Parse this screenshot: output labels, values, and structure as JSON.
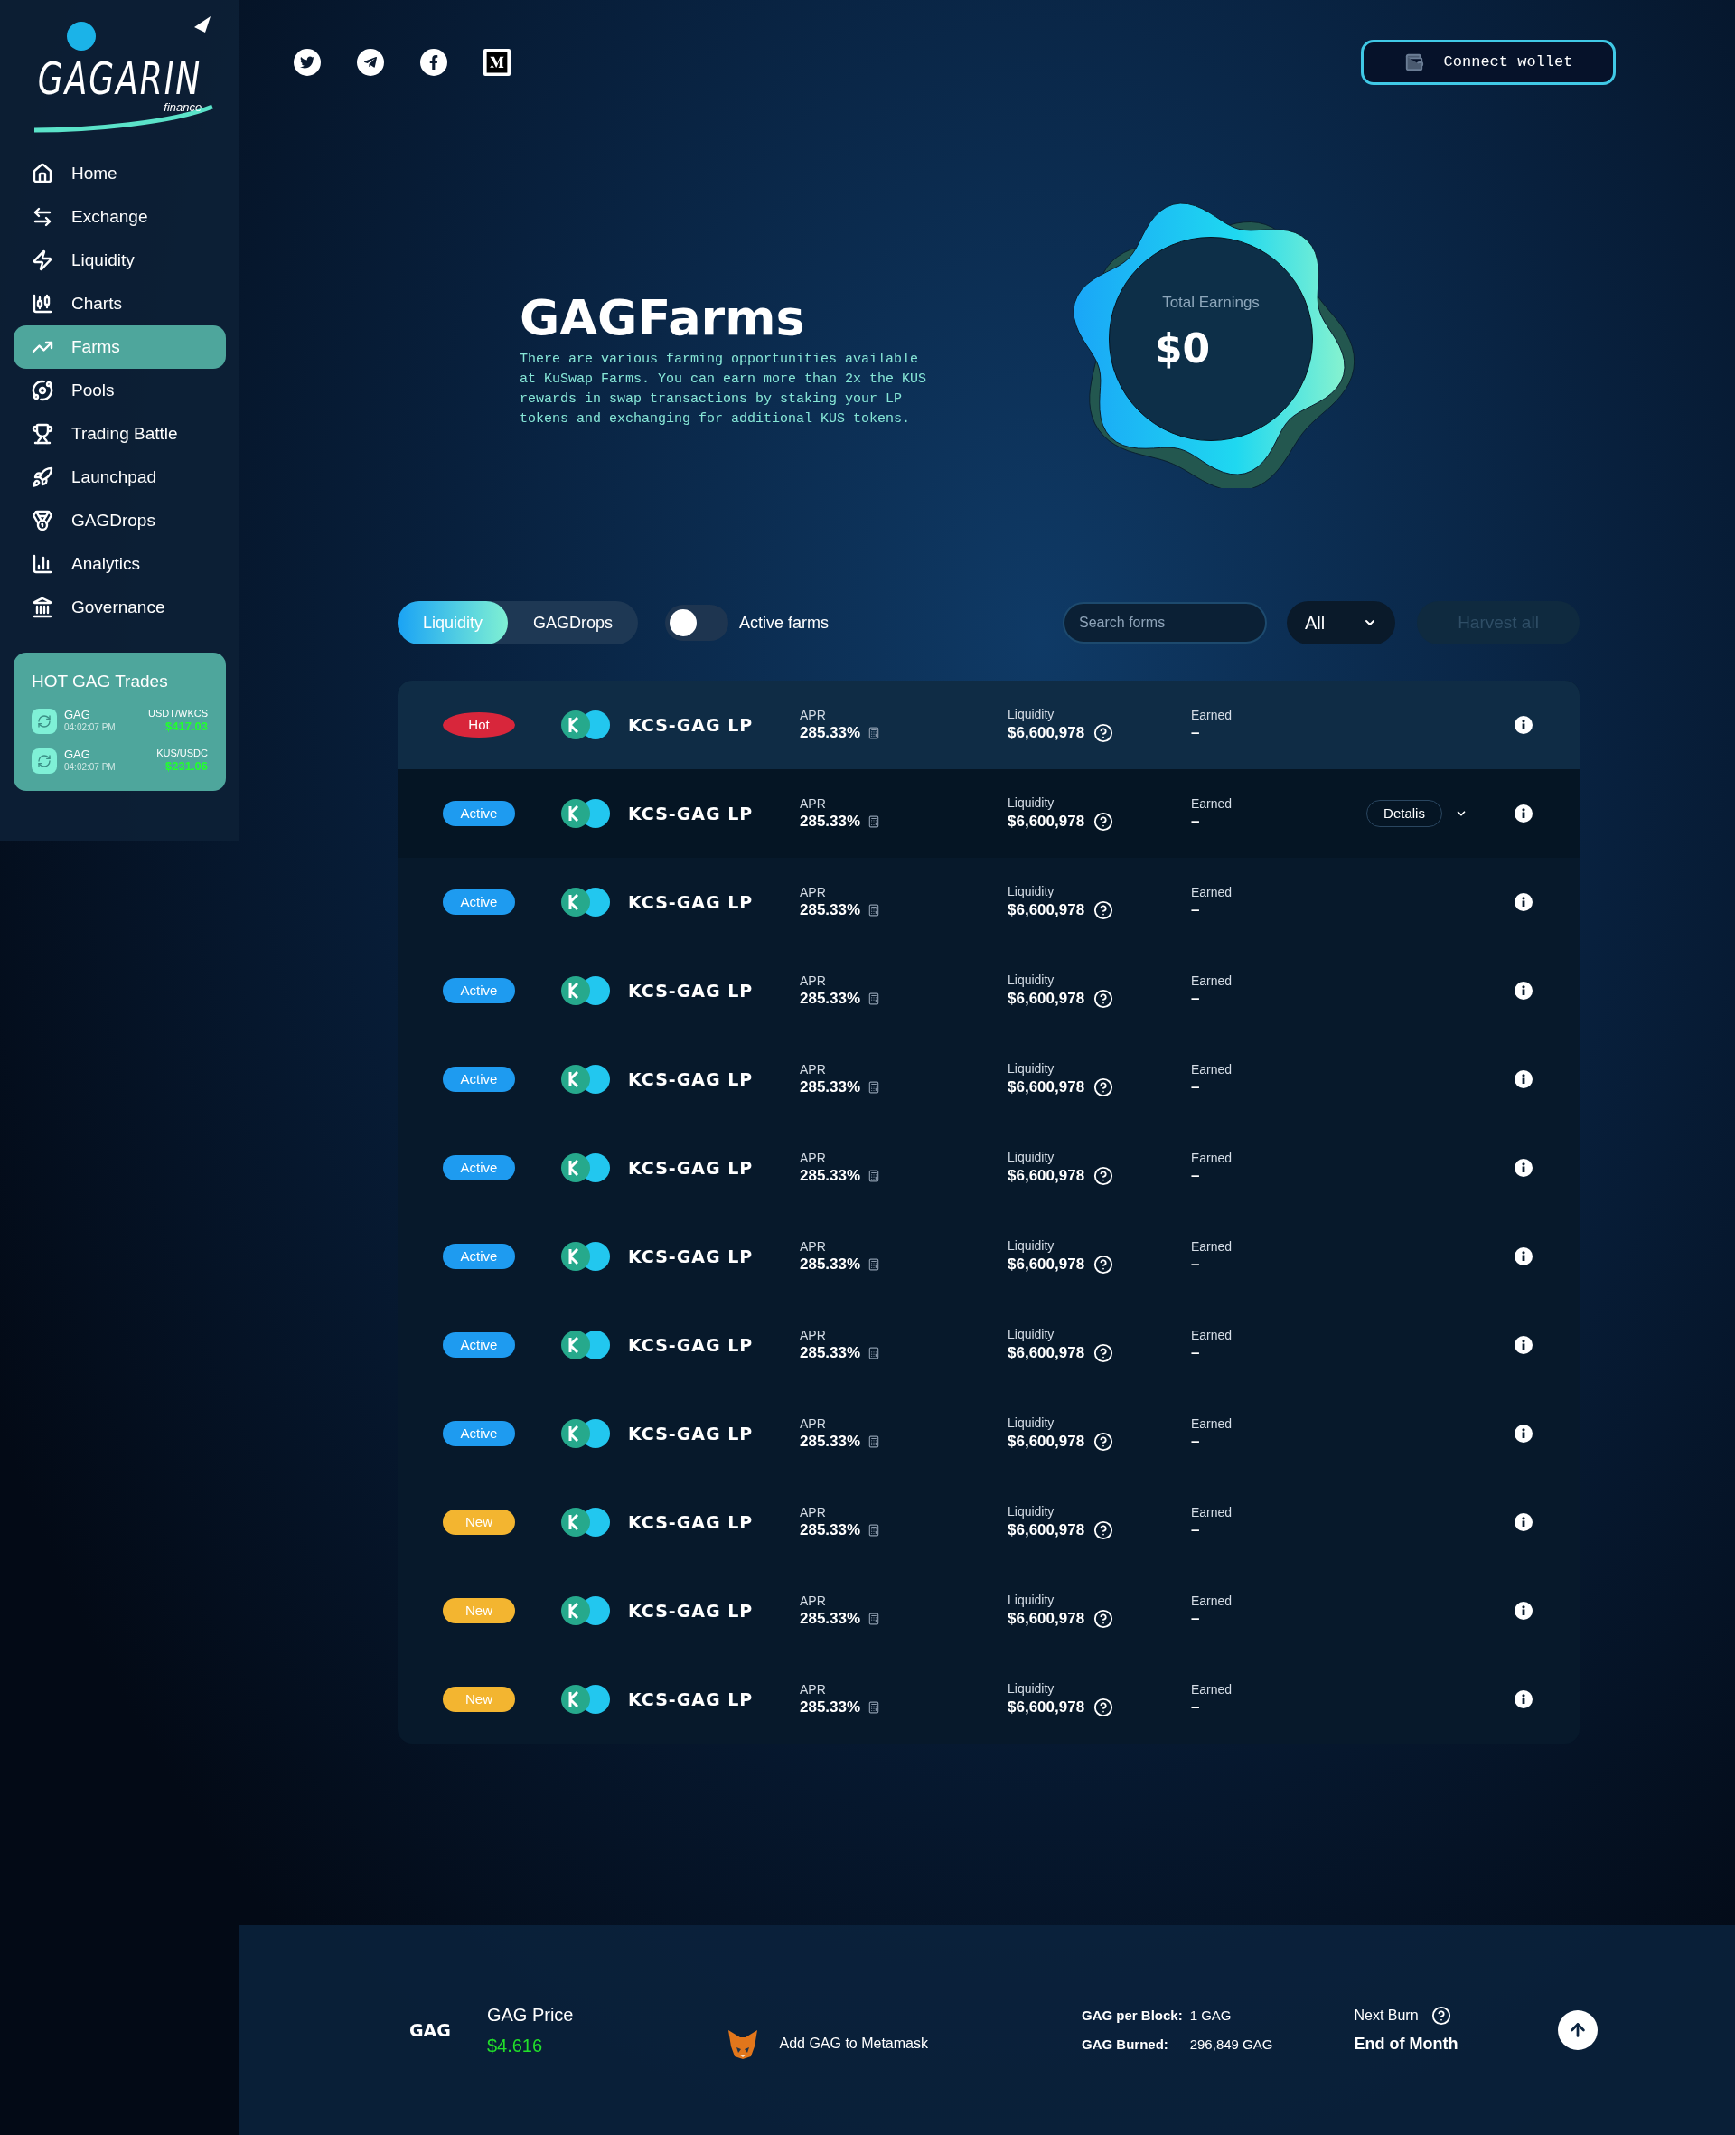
{
  "logo": {
    "name": "GAGARIN",
    "tagline": "finance"
  },
  "sidebar": {
    "items": [
      {
        "label": "Home",
        "selected": false
      },
      {
        "label": "Exchange",
        "selected": false
      },
      {
        "label": "Liquidity",
        "selected": false
      },
      {
        "label": "Charts",
        "selected": false
      },
      {
        "label": "Farms",
        "selected": true
      },
      {
        "label": "Pools",
        "selected": false
      },
      {
        "label": "Trading Battle",
        "selected": false
      },
      {
        "label": "Launchpad",
        "selected": false
      },
      {
        "label": "GAGDrops",
        "selected": false
      },
      {
        "label": "Analytics",
        "selected": false
      },
      {
        "label": "Governance",
        "selected": false
      }
    ]
  },
  "hot_trades": {
    "title": "HOT GAG Trades",
    "items": [
      {
        "token": "GAG",
        "time": "04:02:07 PM",
        "pair": "USDT/WKCS",
        "price": "$417.03"
      },
      {
        "token": "GAG",
        "time": "04:02:07 PM",
        "pair": "KUS/USDC",
        "price": "$231.06"
      }
    ]
  },
  "header": {
    "connect_button": "Connect wollet"
  },
  "hero": {
    "title": "GAGFarms",
    "description": "There are various farming opportunities available at KuSwap Farms. You can earn more than 2x the KUS rewards in swap transactions by staking your LP tokens and exchanging for additional KUS tokens.",
    "earnings_label": "Total Earnings",
    "earnings_value": "$0"
  },
  "filters": {
    "tabs": [
      {
        "label": "Liquidity",
        "selected": true
      },
      {
        "label": "GAGDrops",
        "selected": false
      }
    ],
    "toggle": {
      "label": "Active farms",
      "on": false
    },
    "search": {
      "placeholder": "Search forms"
    },
    "dropdown": "All",
    "harvest_button": {
      "label": "Harvest all",
      "disabled": true
    }
  },
  "farms": [
    {
      "badge": "Hot",
      "kind": "hot",
      "pair": "KCS-GAG LP",
      "apr_label": "APR",
      "apr": "285.33%",
      "liquidity_label": "Liquidity",
      "liquidity": "$6,600,978",
      "earned_label": "Earned",
      "earned": "–"
    },
    {
      "badge": "Active",
      "kind": "active",
      "pair": "KCS-GAG LP",
      "apr_label": "APR",
      "apr": "285.33%",
      "liquidity_label": "Liquidity",
      "liquidity": "$6,600,978",
      "earned_label": "Earned",
      "earned": "–",
      "details": "Detalis"
    },
    {
      "badge": "Active",
      "kind": "active",
      "pair": "KCS-GAG LP",
      "apr_label": "APR",
      "apr": "285.33%",
      "liquidity_label": "Liquidity",
      "liquidity": "$6,600,978",
      "earned_label": "Earned",
      "earned": "–"
    },
    {
      "badge": "Active",
      "kind": "active",
      "pair": "KCS-GAG LP",
      "apr_label": "APR",
      "apr": "285.33%",
      "liquidity_label": "Liquidity",
      "liquidity": "$6,600,978",
      "earned_label": "Earned",
      "earned": "–"
    },
    {
      "badge": "Active",
      "kind": "active",
      "pair": "KCS-GAG LP",
      "apr_label": "APR",
      "apr": "285.33%",
      "liquidity_label": "Liquidity",
      "liquidity": "$6,600,978",
      "earned_label": "Earned",
      "earned": "–"
    },
    {
      "badge": "Active",
      "kind": "active",
      "pair": "KCS-GAG LP",
      "apr_label": "APR",
      "apr": "285.33%",
      "liquidity_label": "Liquidity",
      "liquidity": "$6,600,978",
      "earned_label": "Earned",
      "earned": "–"
    },
    {
      "badge": "Active",
      "kind": "active",
      "pair": "KCS-GAG LP",
      "apr_label": "APR",
      "apr": "285.33%",
      "liquidity_label": "Liquidity",
      "liquidity": "$6,600,978",
      "earned_label": "Earned",
      "earned": "–"
    },
    {
      "badge": "Active",
      "kind": "active",
      "pair": "KCS-GAG LP",
      "apr_label": "APR",
      "apr": "285.33%",
      "liquidity_label": "Liquidity",
      "liquidity": "$6,600,978",
      "earned_label": "Earned",
      "earned": "–"
    },
    {
      "badge": "Active",
      "kind": "active",
      "pair": "KCS-GAG LP",
      "apr_label": "APR",
      "apr": "285.33%",
      "liquidity_label": "Liquidity",
      "liquidity": "$6,600,978",
      "earned_label": "Earned",
      "earned": "–"
    },
    {
      "badge": "New",
      "kind": "new",
      "pair": "KCS-GAG LP",
      "apr_label": "APR",
      "apr": "285.33%",
      "liquidity_label": "Liquidity",
      "liquidity": "$6,600,978",
      "earned_label": "Earned",
      "earned": "–"
    },
    {
      "badge": "New",
      "kind": "new",
      "pair": "KCS-GAG LP",
      "apr_label": "APR",
      "apr": "285.33%",
      "liquidity_label": "Liquidity",
      "liquidity": "$6,600,978",
      "earned_label": "Earned",
      "earned": "–"
    },
    {
      "badge": "New",
      "kind": "new",
      "pair": "KCS-GAG LP",
      "apr_label": "APR",
      "apr": "285.33%",
      "liquidity_label": "Liquidity",
      "liquidity": "$6,600,978",
      "earned_label": "Earned",
      "earned": "–"
    }
  ],
  "footer": {
    "token": "GAG",
    "price_label": "GAG Price",
    "price": "$4.616",
    "metamask": "Add GAG to Metamask",
    "per_block_label": "GAG per Block:",
    "per_block": "1 GAG",
    "burned_label": "GAG Burned:",
    "burned": "296,849 GAG",
    "next_burn_label": "Next Burn",
    "next_burn": "End of Month"
  }
}
